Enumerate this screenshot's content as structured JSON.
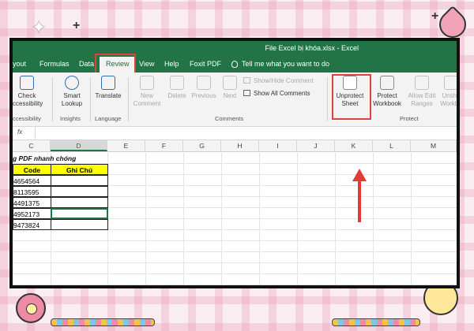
{
  "window": {
    "title": "File Excel bị khóa.xlsx  -  Excel"
  },
  "tabs": [
    {
      "label": "yout"
    },
    {
      "label": "Formulas"
    },
    {
      "label": "Data"
    },
    {
      "label": "Review"
    },
    {
      "label": "View"
    },
    {
      "label": "Help"
    },
    {
      "label": "Foxit PDF"
    }
  ],
  "tell_me": "Tell me what you want to do",
  "ribbon": {
    "check_accessibility": "Check\nccessibility",
    "accessibility_group": "ccessibility",
    "smart_lookup": "Smart\nLookup",
    "insights_group": "Insights",
    "translate": "Translate",
    "language_group": "Language",
    "new_comment": "New\nComment",
    "delete": "Delete",
    "previous": "Previous",
    "next": "Next",
    "show_hide_comment": "Show/Hide Comment",
    "show_all_comments": "Show All Comments",
    "comments_group": "Comments",
    "unprotect_sheet": "Unprotect\nSheet",
    "protect_workbook": "Protect\nWorkbook",
    "allow_edit_ranges": "Allow Edit\nRanges",
    "unshare_workbook": "Unsha\nWorkbo",
    "protect_group": "Protect"
  },
  "formula_bar": {
    "fx": "fx",
    "value": ""
  },
  "columns": [
    "C",
    "D",
    "E",
    "F",
    "G",
    "H",
    "I",
    "J",
    "K",
    "L",
    "M"
  ],
  "sheet": {
    "title_cell": "g PDF nhanh chóng",
    "header_code": "Code",
    "header_note": "Ghi Chú",
    "codes": [
      "4654564",
      "8113595",
      "4491375",
      "4952173",
      "9473824"
    ],
    "notes": [
      "",
      "",
      "",
      "",
      ""
    ]
  },
  "colors": {
    "excel_green": "#227447",
    "highlight_red": "#d9433b",
    "arrow_red": "#e53935",
    "header_yellow": "#ffff00"
  }
}
